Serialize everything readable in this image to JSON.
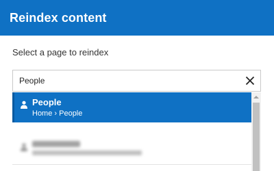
{
  "dialog": {
    "title": "Reindex content",
    "prompt": "Select a page to reindex"
  },
  "search": {
    "value": "People",
    "clear_icon": "close-icon"
  },
  "results": [
    {
      "title": "People",
      "path": "Home › People",
      "icon": "person-icon",
      "selected": true
    }
  ],
  "colors": {
    "accent": "#0f71c4",
    "header_text": "#ffffff",
    "scrollbar_thumb": "#c1c1c1"
  }
}
